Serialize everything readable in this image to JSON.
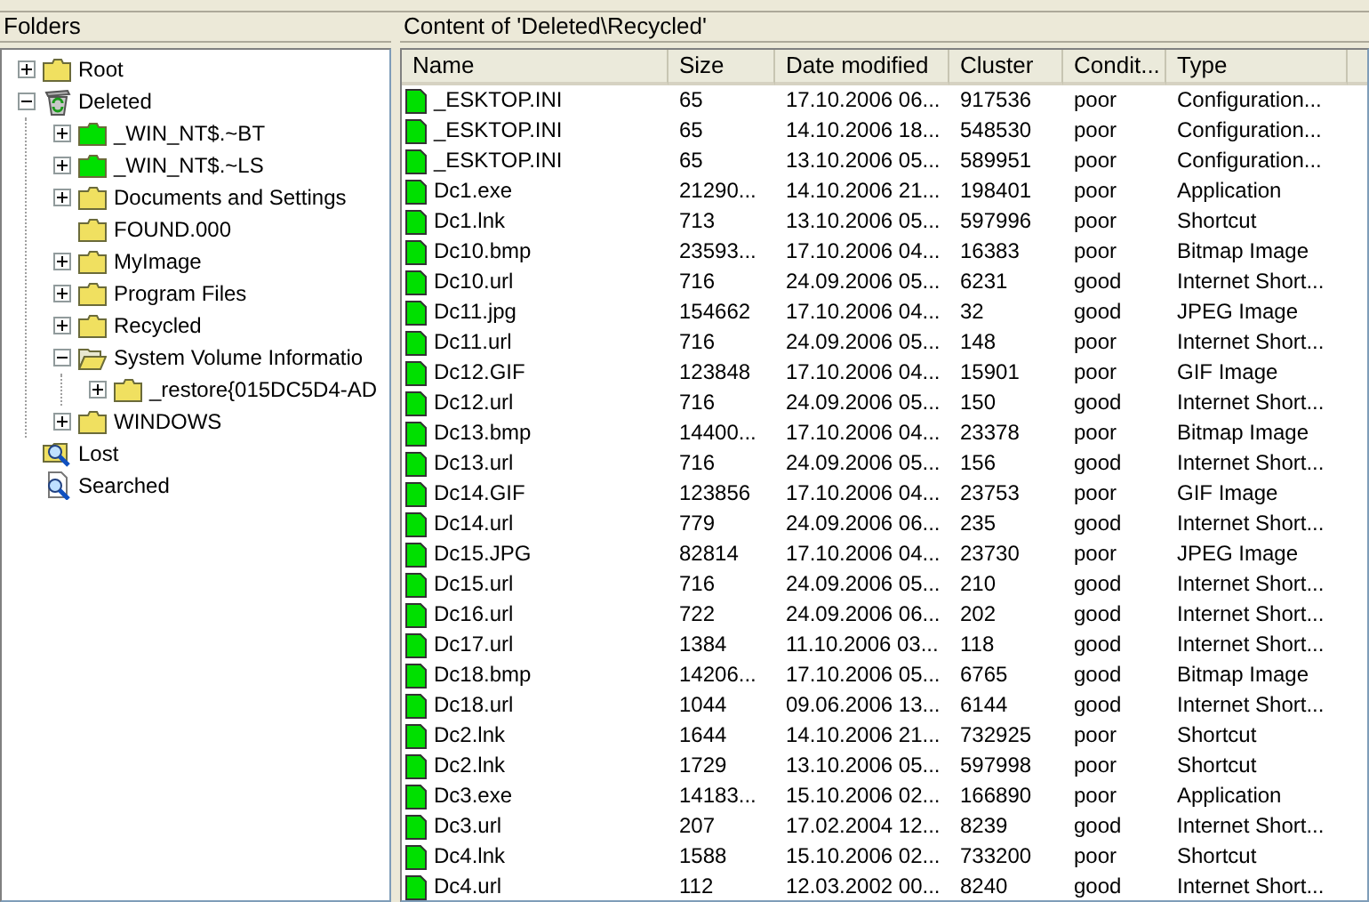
{
  "folders_panel": {
    "title": "Folders",
    "tree": [
      {
        "label": "Root",
        "kind": "folder",
        "color": "#f0e060",
        "expanded": false
      },
      {
        "label": "Deleted",
        "kind": "bin",
        "expanded": true,
        "children": [
          {
            "label": "_WIN_NT$.~BT",
            "kind": "folder",
            "color": "#00e000",
            "expanded": false
          },
          {
            "label": "_WIN_NT$.~LS",
            "kind": "folder",
            "color": "#00e000",
            "expanded": false
          },
          {
            "label": "Documents and Settings",
            "kind": "folder",
            "color": "#f0e060",
            "expanded": false
          },
          {
            "label": "FOUND.000",
            "kind": "folder",
            "color": "#f0e060"
          },
          {
            "label": "MyImage",
            "kind": "folder",
            "color": "#f0e060",
            "expanded": false
          },
          {
            "label": "Program Files",
            "kind": "folder",
            "color": "#f0e060",
            "expanded": false
          },
          {
            "label": "Recycled",
            "kind": "folder",
            "color": "#f0e060",
            "expanded": false
          },
          {
            "label": "System Volume Informatio",
            "kind": "open-folder",
            "color": "#f0e060",
            "expanded": true,
            "children": [
              {
                "label": "_restore{015DC5D4-AD",
                "kind": "folder",
                "color": "#f0e060",
                "expanded": false
              }
            ]
          },
          {
            "label": "WINDOWS",
            "kind": "folder",
            "color": "#f0e060",
            "expanded": false
          }
        ]
      },
      {
        "label": "Lost",
        "kind": "lost"
      },
      {
        "label": "Searched",
        "kind": "searched"
      }
    ]
  },
  "content_panel": {
    "title": "Content of 'Deleted\\Recycled'",
    "columns": [
      "Name",
      "Size",
      "Date modified",
      "Cluster",
      "Condit...",
      "Type"
    ],
    "rows": [
      [
        "_ESKTOP.INI",
        "65",
        "17.10.2006 06...",
        "917536",
        "poor",
        "Configuration..."
      ],
      [
        "_ESKTOP.INI",
        "65",
        "14.10.2006 18...",
        "548530",
        "poor",
        "Configuration..."
      ],
      [
        "_ESKTOP.INI",
        "65",
        "13.10.2006 05...",
        "589951",
        "poor",
        "Configuration..."
      ],
      [
        "Dc1.exe",
        "21290...",
        "14.10.2006 21...",
        "198401",
        "poor",
        "Application"
      ],
      [
        "Dc1.lnk",
        "713",
        "13.10.2006 05...",
        "597996",
        "poor",
        "Shortcut"
      ],
      [
        "Dc10.bmp",
        "23593...",
        "17.10.2006 04...",
        "16383",
        "poor",
        "Bitmap Image"
      ],
      [
        "Dc10.url",
        "716",
        "24.09.2006 05...",
        "6231",
        "good",
        "Internet Short..."
      ],
      [
        "Dc11.jpg",
        "154662",
        "17.10.2006 04...",
        "32",
        "good",
        "JPEG Image"
      ],
      [
        "Dc11.url",
        "716",
        "24.09.2006 05...",
        "148",
        "poor",
        "Internet Short..."
      ],
      [
        "Dc12.GIF",
        "123848",
        "17.10.2006 04...",
        "15901",
        "poor",
        "GIF Image"
      ],
      [
        "Dc12.url",
        "716",
        "24.09.2006 05...",
        "150",
        "good",
        "Internet Short..."
      ],
      [
        "Dc13.bmp",
        "14400...",
        "17.10.2006 04...",
        "23378",
        "poor",
        "Bitmap Image"
      ],
      [
        "Dc13.url",
        "716",
        "24.09.2006 05...",
        "156",
        "good",
        "Internet Short..."
      ],
      [
        "Dc14.GIF",
        "123856",
        "17.10.2006 04...",
        "23753",
        "poor",
        "GIF Image"
      ],
      [
        "Dc14.url",
        "779",
        "24.09.2006 06...",
        "235",
        "good",
        "Internet Short..."
      ],
      [
        "Dc15.JPG",
        "82814",
        "17.10.2006 04...",
        "23730",
        "poor",
        "JPEG Image"
      ],
      [
        "Dc15.url",
        "716",
        "24.09.2006 05...",
        "210",
        "good",
        "Internet Short..."
      ],
      [
        "Dc16.url",
        "722",
        "24.09.2006 06...",
        "202",
        "good",
        "Internet Short..."
      ],
      [
        "Dc17.url",
        "1384",
        "11.10.2006 03...",
        "118",
        "good",
        "Internet Short..."
      ],
      [
        "Dc18.bmp",
        "14206...",
        "17.10.2006 05...",
        "6765",
        "good",
        "Bitmap Image"
      ],
      [
        "Dc18.url",
        "1044",
        "09.06.2006 13...",
        "6144",
        "good",
        "Internet Short..."
      ],
      [
        "Dc2.lnk",
        "1644",
        "14.10.2006 21...",
        "732925",
        "poor",
        "Shortcut"
      ],
      [
        "Dc2.lnk",
        "1729",
        "13.10.2006 05...",
        "597998",
        "poor",
        "Shortcut"
      ],
      [
        "Dc3.exe",
        "14183...",
        "15.10.2006 02...",
        "166890",
        "poor",
        "Application"
      ],
      [
        "Dc3.url",
        "207",
        "17.02.2004 12...",
        "8239",
        "good",
        "Internet Short..."
      ],
      [
        "Dc4.lnk",
        "1588",
        "15.10.2006 02...",
        "733200",
        "poor",
        "Shortcut"
      ],
      [
        "Dc4.url",
        "112",
        "12.03.2002 00...",
        "8240",
        "good",
        "Internet Short..."
      ]
    ]
  }
}
